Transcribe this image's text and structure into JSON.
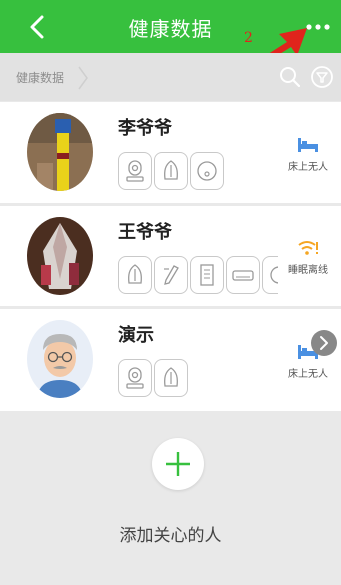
{
  "header": {
    "title": "健康数据",
    "annotation_number": "2",
    "background_color": "#37c03e",
    "back_icon": "chevron-left-icon",
    "more_icon": "more-horizontal-icon"
  },
  "breadcrumb": {
    "label": "健康数据",
    "search_icon": "search-icon",
    "filter_icon": "filter-icon"
  },
  "people": [
    {
      "name": "李爷爷",
      "devices": [
        "camera-icon",
        "sleep-belt-icon",
        "toilet-sensor-icon"
      ],
      "status_icon": "bed-icon",
      "status_text": "床上无人",
      "status_color": "#4a90e2"
    },
    {
      "name": "王爷爷",
      "devices": [
        "sleep-belt-icon",
        "thermometer-icon",
        "door-sensor-icon",
        "air-conditioner-icon",
        "device-icon"
      ],
      "status_icon": "wifi-warning-icon",
      "status_text": "睡眠离线",
      "status_color": "#f5a623"
    },
    {
      "name": "演示",
      "devices": [
        "camera-icon",
        "sleep-belt-icon"
      ],
      "status_icon": "bed-icon",
      "status_text": "床上无人",
      "status_color": "#4a90e2"
    }
  ],
  "add": {
    "label": "添加关心的人",
    "icon": "plus-icon",
    "accent": "#37c03e"
  }
}
